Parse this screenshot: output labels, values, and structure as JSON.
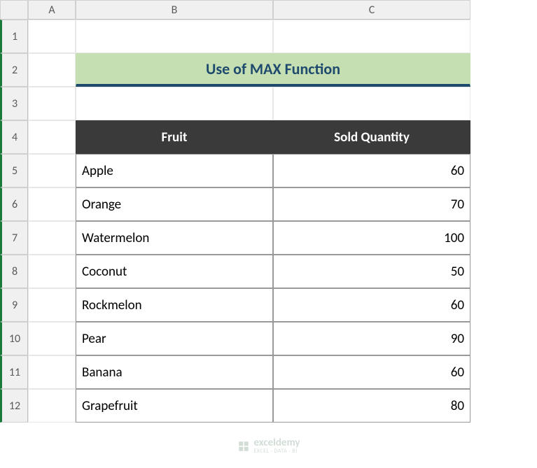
{
  "columns": [
    "A",
    "B",
    "C"
  ],
  "rows": [
    "1",
    "2",
    "3",
    "4",
    "5",
    "6",
    "7",
    "8",
    "9",
    "10",
    "11",
    "12"
  ],
  "title": "Use of MAX Function",
  "headers": {
    "fruit": "Fruit",
    "qty": "Sold Quantity"
  },
  "data": [
    {
      "fruit": "Apple",
      "qty": "60"
    },
    {
      "fruit": "Orange",
      "qty": "70"
    },
    {
      "fruit": "Watermelon",
      "qty": "100"
    },
    {
      "fruit": "Coconut",
      "qty": "50"
    },
    {
      "fruit": "Rockmelon",
      "qty": "60"
    },
    {
      "fruit": "Pear",
      "qty": "90"
    },
    {
      "fruit": "Banana",
      "qty": "60"
    },
    {
      "fruit": "Grapefruit",
      "qty": "80"
    }
  ],
  "watermark": {
    "brand": "exceldemy",
    "tag": "EXCEL · DATA · BI"
  }
}
